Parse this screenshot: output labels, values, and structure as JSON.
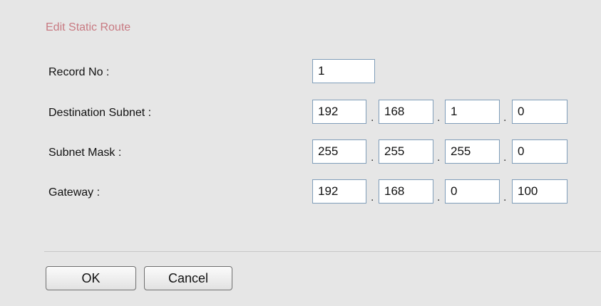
{
  "dialog": {
    "title": "Edit Static Route"
  },
  "form": {
    "record_no": {
      "label": "Record No :",
      "value": "1"
    },
    "destination_subnet": {
      "label": "Destination Subnet :",
      "octets": [
        "192",
        "168",
        "1",
        "0"
      ]
    },
    "subnet_mask": {
      "label": "Subnet Mask :",
      "octets": [
        "255",
        "255",
        "255",
        "0"
      ]
    },
    "gateway": {
      "label": "Gateway :",
      "octets": [
        "192",
        "168",
        "0",
        "100"
      ]
    },
    "octet_separator": "."
  },
  "buttons": {
    "ok_label": "OK",
    "cancel_label": "Cancel"
  }
}
